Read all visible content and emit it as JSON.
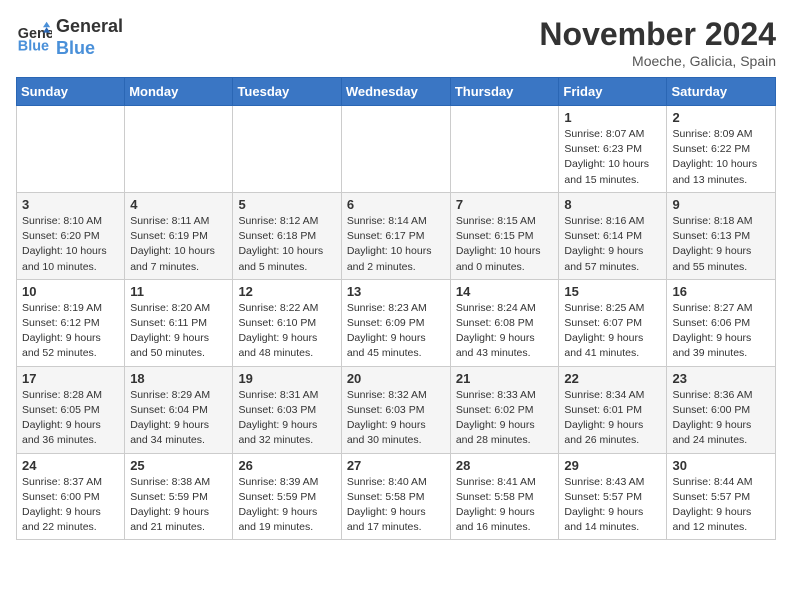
{
  "logo": {
    "line1": "General",
    "line2": "Blue"
  },
  "title": "November 2024",
  "location": "Moeche, Galicia, Spain",
  "weekdays": [
    "Sunday",
    "Monday",
    "Tuesday",
    "Wednesday",
    "Thursday",
    "Friday",
    "Saturday"
  ],
  "weeks": [
    [
      {
        "day": "",
        "sunrise": "",
        "sunset": "",
        "daylight": ""
      },
      {
        "day": "",
        "sunrise": "",
        "sunset": "",
        "daylight": ""
      },
      {
        "day": "",
        "sunrise": "",
        "sunset": "",
        "daylight": ""
      },
      {
        "day": "",
        "sunrise": "",
        "sunset": "",
        "daylight": ""
      },
      {
        "day": "",
        "sunrise": "",
        "sunset": "",
        "daylight": ""
      },
      {
        "day": "1",
        "sunrise": "Sunrise: 8:07 AM",
        "sunset": "Sunset: 6:23 PM",
        "daylight": "Daylight: 10 hours and 15 minutes."
      },
      {
        "day": "2",
        "sunrise": "Sunrise: 8:09 AM",
        "sunset": "Sunset: 6:22 PM",
        "daylight": "Daylight: 10 hours and 13 minutes."
      }
    ],
    [
      {
        "day": "3",
        "sunrise": "Sunrise: 8:10 AM",
        "sunset": "Sunset: 6:20 PM",
        "daylight": "Daylight: 10 hours and 10 minutes."
      },
      {
        "day": "4",
        "sunrise": "Sunrise: 8:11 AM",
        "sunset": "Sunset: 6:19 PM",
        "daylight": "Daylight: 10 hours and 7 minutes."
      },
      {
        "day": "5",
        "sunrise": "Sunrise: 8:12 AM",
        "sunset": "Sunset: 6:18 PM",
        "daylight": "Daylight: 10 hours and 5 minutes."
      },
      {
        "day": "6",
        "sunrise": "Sunrise: 8:14 AM",
        "sunset": "Sunset: 6:17 PM",
        "daylight": "Daylight: 10 hours and 2 minutes."
      },
      {
        "day": "7",
        "sunrise": "Sunrise: 8:15 AM",
        "sunset": "Sunset: 6:15 PM",
        "daylight": "Daylight: 10 hours and 0 minutes."
      },
      {
        "day": "8",
        "sunrise": "Sunrise: 8:16 AM",
        "sunset": "Sunset: 6:14 PM",
        "daylight": "Daylight: 9 hours and 57 minutes."
      },
      {
        "day": "9",
        "sunrise": "Sunrise: 8:18 AM",
        "sunset": "Sunset: 6:13 PM",
        "daylight": "Daylight: 9 hours and 55 minutes."
      }
    ],
    [
      {
        "day": "10",
        "sunrise": "Sunrise: 8:19 AM",
        "sunset": "Sunset: 6:12 PM",
        "daylight": "Daylight: 9 hours and 52 minutes."
      },
      {
        "day": "11",
        "sunrise": "Sunrise: 8:20 AM",
        "sunset": "Sunset: 6:11 PM",
        "daylight": "Daylight: 9 hours and 50 minutes."
      },
      {
        "day": "12",
        "sunrise": "Sunrise: 8:22 AM",
        "sunset": "Sunset: 6:10 PM",
        "daylight": "Daylight: 9 hours and 48 minutes."
      },
      {
        "day": "13",
        "sunrise": "Sunrise: 8:23 AM",
        "sunset": "Sunset: 6:09 PM",
        "daylight": "Daylight: 9 hours and 45 minutes."
      },
      {
        "day": "14",
        "sunrise": "Sunrise: 8:24 AM",
        "sunset": "Sunset: 6:08 PM",
        "daylight": "Daylight: 9 hours and 43 minutes."
      },
      {
        "day": "15",
        "sunrise": "Sunrise: 8:25 AM",
        "sunset": "Sunset: 6:07 PM",
        "daylight": "Daylight: 9 hours and 41 minutes."
      },
      {
        "day": "16",
        "sunrise": "Sunrise: 8:27 AM",
        "sunset": "Sunset: 6:06 PM",
        "daylight": "Daylight: 9 hours and 39 minutes."
      }
    ],
    [
      {
        "day": "17",
        "sunrise": "Sunrise: 8:28 AM",
        "sunset": "Sunset: 6:05 PM",
        "daylight": "Daylight: 9 hours and 36 minutes."
      },
      {
        "day": "18",
        "sunrise": "Sunrise: 8:29 AM",
        "sunset": "Sunset: 6:04 PM",
        "daylight": "Daylight: 9 hours and 34 minutes."
      },
      {
        "day": "19",
        "sunrise": "Sunrise: 8:31 AM",
        "sunset": "Sunset: 6:03 PM",
        "daylight": "Daylight: 9 hours and 32 minutes."
      },
      {
        "day": "20",
        "sunrise": "Sunrise: 8:32 AM",
        "sunset": "Sunset: 6:03 PM",
        "daylight": "Daylight: 9 hours and 30 minutes."
      },
      {
        "day": "21",
        "sunrise": "Sunrise: 8:33 AM",
        "sunset": "Sunset: 6:02 PM",
        "daylight": "Daylight: 9 hours and 28 minutes."
      },
      {
        "day": "22",
        "sunrise": "Sunrise: 8:34 AM",
        "sunset": "Sunset: 6:01 PM",
        "daylight": "Daylight: 9 hours and 26 minutes."
      },
      {
        "day": "23",
        "sunrise": "Sunrise: 8:36 AM",
        "sunset": "Sunset: 6:00 PM",
        "daylight": "Daylight: 9 hours and 24 minutes."
      }
    ],
    [
      {
        "day": "24",
        "sunrise": "Sunrise: 8:37 AM",
        "sunset": "Sunset: 6:00 PM",
        "daylight": "Daylight: 9 hours and 22 minutes."
      },
      {
        "day": "25",
        "sunrise": "Sunrise: 8:38 AM",
        "sunset": "Sunset: 5:59 PM",
        "daylight": "Daylight: 9 hours and 21 minutes."
      },
      {
        "day": "26",
        "sunrise": "Sunrise: 8:39 AM",
        "sunset": "Sunset: 5:59 PM",
        "daylight": "Daylight: 9 hours and 19 minutes."
      },
      {
        "day": "27",
        "sunrise": "Sunrise: 8:40 AM",
        "sunset": "Sunset: 5:58 PM",
        "daylight": "Daylight: 9 hours and 17 minutes."
      },
      {
        "day": "28",
        "sunrise": "Sunrise: 8:41 AM",
        "sunset": "Sunset: 5:58 PM",
        "daylight": "Daylight: 9 hours and 16 minutes."
      },
      {
        "day": "29",
        "sunrise": "Sunrise: 8:43 AM",
        "sunset": "Sunset: 5:57 PM",
        "daylight": "Daylight: 9 hours and 14 minutes."
      },
      {
        "day": "30",
        "sunrise": "Sunrise: 8:44 AM",
        "sunset": "Sunset: 5:57 PM",
        "daylight": "Daylight: 9 hours and 12 minutes."
      }
    ]
  ]
}
